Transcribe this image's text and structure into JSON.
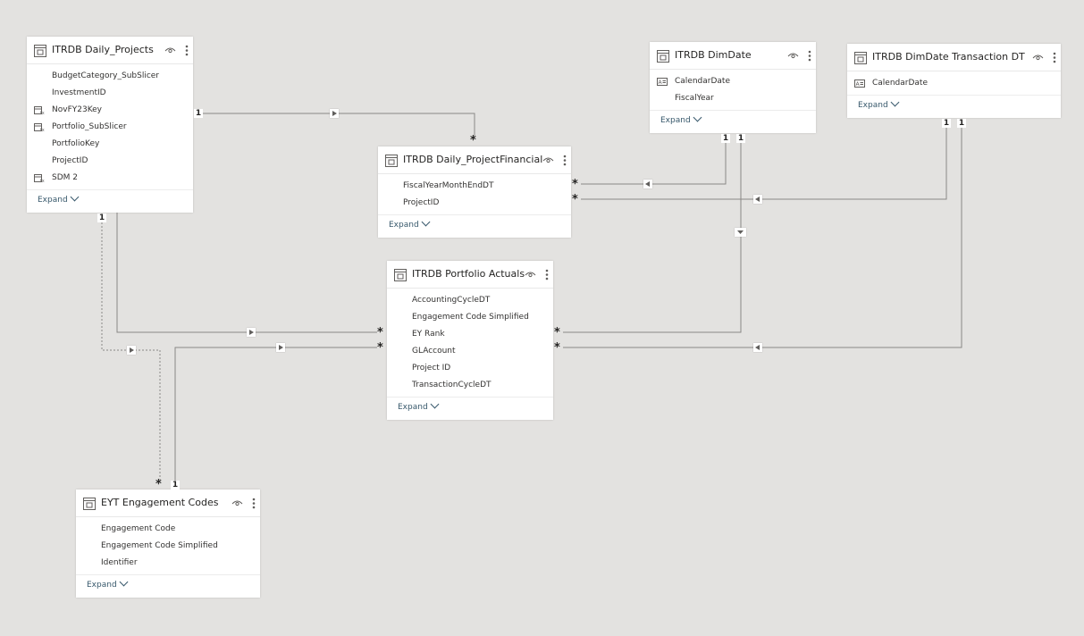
{
  "tables": {
    "daily_projects": {
      "title": "ITRDB Daily_Projects",
      "fields": [
        {
          "name": "BudgetCategory_SubSlicer",
          "icon": ""
        },
        {
          "name": "InvestmentID",
          "icon": ""
        },
        {
          "name": "NovFY23Key",
          "icon": "calculated-column-icon"
        },
        {
          "name": "Portfolio_SubSlicer",
          "icon": "calculated-column-icon"
        },
        {
          "name": "PortfolioKey",
          "icon": ""
        },
        {
          "name": "ProjectID",
          "icon": ""
        },
        {
          "name": "SDM 2",
          "icon": "calculated-column-icon"
        }
      ],
      "expand": "Expand"
    },
    "dim_date": {
      "title": "ITRDB DimDate",
      "fields": [
        {
          "name": "CalendarDate",
          "icon": "text-field-icon"
        },
        {
          "name": "FiscalYear",
          "icon": ""
        }
      ],
      "expand": "Expand"
    },
    "dim_date_transaction": {
      "title": "ITRDB DimDate Transaction DT",
      "fields": [
        {
          "name": "CalendarDate",
          "icon": "text-field-icon"
        }
      ],
      "expand": "Expand"
    },
    "project_financial": {
      "title": "ITRDB Daily_ProjectFinancial",
      "fields": [
        {
          "name": "FiscalYearMonthEndDT",
          "icon": ""
        },
        {
          "name": "ProjectID",
          "icon": ""
        }
      ],
      "expand": "Expand"
    },
    "portfolio_actuals": {
      "title": "ITRDB Portfolio Actuals",
      "fields": [
        {
          "name": "AccountingCycleDT",
          "icon": ""
        },
        {
          "name": "Engagement Code Simplified",
          "icon": ""
        },
        {
          "name": "EY Rank",
          "icon": ""
        },
        {
          "name": "GLAccount",
          "icon": ""
        },
        {
          "name": "Project ID",
          "icon": ""
        },
        {
          "name": "TransactionCycleDT",
          "icon": ""
        }
      ],
      "expand": "Expand"
    },
    "engagement_codes": {
      "title": "EYT Engagement Codes",
      "fields": [
        {
          "name": "Engagement Code",
          "icon": ""
        },
        {
          "name": "Engagement Code Simplified",
          "icon": ""
        },
        {
          "name": "Identifier",
          "icon": ""
        }
      ],
      "expand": "Expand"
    }
  },
  "cardinality": {
    "one": "1",
    "many": "*"
  },
  "colors": {
    "canvas": "#e3e2e0",
    "line": "#8a8886",
    "link_text": "#37586b"
  }
}
